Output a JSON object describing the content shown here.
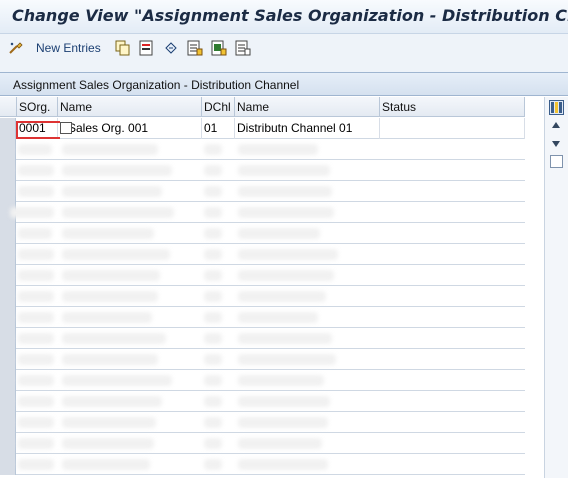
{
  "window": {
    "title": "Change View \"Assignment Sales Organization - Distribution Channel\": Overview"
  },
  "toolbar": {
    "new_entries_label": "New Entries",
    "icons": [
      "new-entries-icon",
      "copy-icon",
      "delete-icon",
      "undo-icon",
      "select-all-icon",
      "select-block-icon",
      "deselect-all-icon"
    ]
  },
  "panel": {
    "title": "Assignment Sales Organization - Distribution Channel"
  },
  "table": {
    "headers": {
      "sorg": "SOrg.",
      "name1": "Name",
      "dchl": "DChl",
      "name2": "Name",
      "status": "Status"
    },
    "rows": [
      {
        "sorg": "0001",
        "name1": "Sales Org. 001",
        "dchl": "01",
        "name2": "Distributn Channel 01",
        "status": ""
      }
    ]
  },
  "colors": {
    "title_text": "#1b2b44",
    "link_text": "#1b3f72",
    "header_bg": "#dbe5f1",
    "focus_red": "#dd3333"
  }
}
